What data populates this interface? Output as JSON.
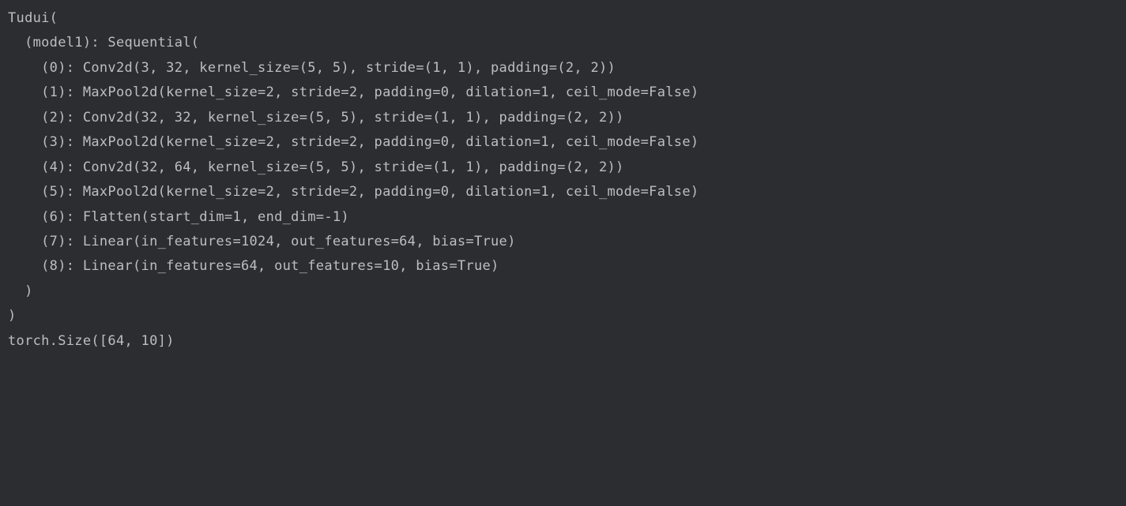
{
  "output": {
    "lines": [
      "Tudui(",
      "  (model1): Sequential(",
      "    (0): Conv2d(3, 32, kernel_size=(5, 5), stride=(1, 1), padding=(2, 2))",
      "    (1): MaxPool2d(kernel_size=2, stride=2, padding=0, dilation=1, ceil_mode=False)",
      "    (2): Conv2d(32, 32, kernel_size=(5, 5), stride=(1, 1), padding=(2, 2))",
      "    (3): MaxPool2d(kernel_size=2, stride=2, padding=0, dilation=1, ceil_mode=False)",
      "    (4): Conv2d(32, 64, kernel_size=(5, 5), stride=(1, 1), padding=(2, 2))",
      "    (5): MaxPool2d(kernel_size=2, stride=2, padding=0, dilation=1, ceil_mode=False)",
      "    (6): Flatten(start_dim=1, end_dim=-1)",
      "    (7): Linear(in_features=1024, out_features=64, bias=True)",
      "    (8): Linear(in_features=64, out_features=10, bias=True)",
      "  )",
      ")",
      "torch.Size([64, 10])"
    ]
  }
}
